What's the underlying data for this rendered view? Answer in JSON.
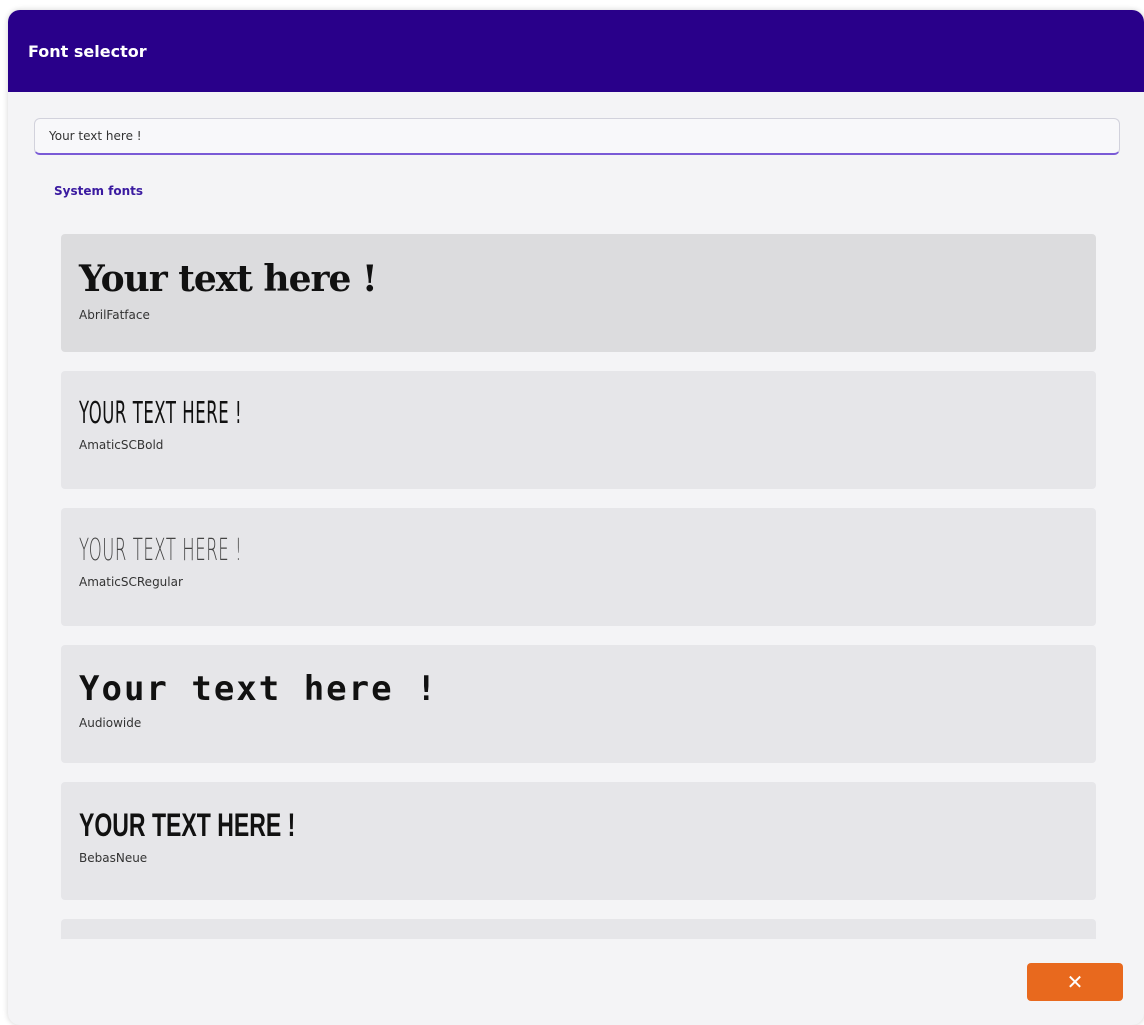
{
  "dialog": {
    "title": "Font selector",
    "search": {
      "value": "Your text here !"
    },
    "section_label": "System fonts",
    "fonts": [
      {
        "sample": "Your text here !",
        "name": "AbrilFatface"
      },
      {
        "sample": "Your text here !",
        "name": "AmaticSCBold"
      },
      {
        "sample": "Your text here !",
        "name": "AmaticSCRegular"
      },
      {
        "sample": "Your text here !",
        "name": "Audiowide"
      },
      {
        "sample": "Your text here !",
        "name": "BebasNeue"
      }
    ],
    "close_button": {
      "icon": "close-icon",
      "glyph": "✕",
      "color": "#e8691e"
    }
  },
  "colors": {
    "header": "#29008a",
    "accent": "#3a1aa0",
    "card": "#e6e6e9"
  }
}
